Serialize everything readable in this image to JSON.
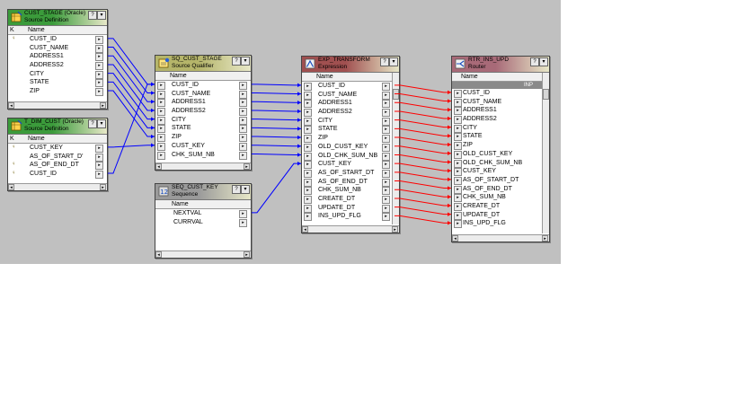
{
  "colors": {
    "source_header": "#3b9b3b",
    "qualifier_header": "#b5b56a",
    "sequence_header": "#9a9a9a",
    "expression_header": "#a05050",
    "router_header": "#a86a78",
    "wire_blue": "#0000ff",
    "wire_red": "#ff0000"
  },
  "transforms": [
    {
      "id": "src1",
      "title": "CUST_STAGE (Oracle)",
      "subtitle": "Source Definition",
      "icon": "source-definition-icon",
      "header": {
        "key": "K",
        "name": "Name"
      },
      "ports": [
        {
          "key": "key-icon",
          "name": "CUST_ID"
        },
        {
          "name": "CUST_NAME"
        },
        {
          "name": "ADDRESS1"
        },
        {
          "name": "ADDRESS2"
        },
        {
          "name": "CITY"
        },
        {
          "name": "STATE"
        },
        {
          "name": "ZIP"
        }
      ]
    },
    {
      "id": "src2",
      "title": "T_DIM_CUST (Oracle)",
      "subtitle": "Source Definition",
      "icon": "source-definition-icon",
      "header": {
        "key": "K",
        "name": "Name"
      },
      "ports": [
        {
          "key": "key-icon",
          "name": "CUST_KEY"
        },
        {
          "name": "AS_OF_START_D'"
        },
        {
          "key": "key-icon",
          "name": "AS_OF_END_DT"
        },
        {
          "key": "key-icon",
          "name": "CUST_ID"
        }
      ]
    },
    {
      "id": "sq",
      "title": "SQ_CUST_STAGE",
      "subtitle": "Source Qualifier",
      "icon": "source-qualifier-icon",
      "header": {
        "name": "Name"
      },
      "ports": [
        {
          "name": "CUST_ID"
        },
        {
          "name": "CUST_NAME"
        },
        {
          "name": "ADDRESS1"
        },
        {
          "name": "ADDRESS2"
        },
        {
          "name": "CITY"
        },
        {
          "name": "STATE"
        },
        {
          "name": "ZIP"
        },
        {
          "name": "CUST_KEY"
        },
        {
          "name": "CHK_SUM_NB"
        }
      ]
    },
    {
      "id": "seq",
      "title": "SEQ_CUST_KEY",
      "subtitle": "Sequence",
      "icon": "sequence-icon",
      "header": {
        "name": "Name"
      },
      "ports": [
        {
          "name": "NEXTVAL"
        },
        {
          "name": "CURRVAL"
        }
      ]
    },
    {
      "id": "exp",
      "title": "EXP_TRANSFORM",
      "subtitle": "Expression",
      "icon": "expression-icon",
      "header": {
        "name": "Name"
      },
      "ports": [
        {
          "name": "CUST_ID"
        },
        {
          "name": "CUST_NAME"
        },
        {
          "name": "ADDRESS1"
        },
        {
          "name": "ADDRESS2"
        },
        {
          "name": "CITY"
        },
        {
          "name": "STATE"
        },
        {
          "name": "ZIP"
        },
        {
          "name": "OLD_CUST_KEY"
        },
        {
          "name": "OLD_CHK_SUM_NB"
        },
        {
          "name": "CUST_KEY"
        },
        {
          "name": "AS_OF_START_DT"
        },
        {
          "name": "AS_OF_END_DT"
        },
        {
          "name": "CHK_SUM_NB"
        },
        {
          "name": "CREATE_DT"
        },
        {
          "name": "UPDATE_DT"
        },
        {
          "name": "INS_UPD_FLG"
        }
      ]
    },
    {
      "id": "rtr",
      "title": "RTR_INS_UPD",
      "subtitle": "Router",
      "icon": "router-icon",
      "header": {
        "name": "Name"
      },
      "group_label": "INP",
      "ports": [
        {
          "name": "CUST_ID"
        },
        {
          "name": "CUST_NAME"
        },
        {
          "name": "ADDRESS1"
        },
        {
          "name": "ADDRESS2"
        },
        {
          "name": "CITY"
        },
        {
          "name": "STATE"
        },
        {
          "name": "ZIP"
        },
        {
          "name": "OLD_CUST_KEY"
        },
        {
          "name": "OLD_CHK_SUM_NB"
        },
        {
          "name": "CUST_KEY"
        },
        {
          "name": "AS_OF_START_DT"
        },
        {
          "name": "AS_OF_END_DT"
        },
        {
          "name": "CHK_SUM_NB"
        },
        {
          "name": "CREATE_DT"
        },
        {
          "name": "UPDATE_DT"
        },
        {
          "name": "INS_UPD_FLG"
        }
      ]
    }
  ],
  "links": [
    {
      "from": "src1.0",
      "to": "sq.0",
      "color": "blue"
    },
    {
      "from": "src1.1",
      "to": "sq.1",
      "color": "blue"
    },
    {
      "from": "src1.2",
      "to": "sq.2",
      "color": "blue"
    },
    {
      "from": "src1.3",
      "to": "sq.3",
      "color": "blue"
    },
    {
      "from": "src1.4",
      "to": "sq.4",
      "color": "blue"
    },
    {
      "from": "src1.5",
      "to": "sq.5",
      "color": "blue"
    },
    {
      "from": "src1.6",
      "to": "sq.6",
      "color": "blue"
    },
    {
      "from": "src2.0",
      "to": "sq.7",
      "color": "blue"
    },
    {
      "from": "src2.3",
      "to": "sq.0",
      "color": "blue"
    },
    {
      "from": "sq.0",
      "to": "exp.0",
      "color": "blue"
    },
    {
      "from": "sq.1",
      "to": "exp.1",
      "color": "blue"
    },
    {
      "from": "sq.2",
      "to": "exp.2",
      "color": "blue"
    },
    {
      "from": "sq.3",
      "to": "exp.3",
      "color": "blue"
    },
    {
      "from": "sq.4",
      "to": "exp.4",
      "color": "blue"
    },
    {
      "from": "sq.5",
      "to": "exp.5",
      "color": "blue"
    },
    {
      "from": "sq.6",
      "to": "exp.6",
      "color": "blue"
    },
    {
      "from": "sq.7",
      "to": "exp.7",
      "color": "blue"
    },
    {
      "from": "sq.8",
      "to": "exp.8",
      "color": "blue"
    },
    {
      "from": "seq.0",
      "to": "exp.9",
      "color": "blue"
    },
    {
      "from": "exp.0",
      "to": "rtr.0",
      "color": "red"
    },
    {
      "from": "exp.1",
      "to": "rtr.1",
      "color": "red"
    },
    {
      "from": "exp.2",
      "to": "rtr.2",
      "color": "red"
    },
    {
      "from": "exp.3",
      "to": "rtr.3",
      "color": "red"
    },
    {
      "from": "exp.4",
      "to": "rtr.4",
      "color": "red"
    },
    {
      "from": "exp.5",
      "to": "rtr.5",
      "color": "red"
    },
    {
      "from": "exp.6",
      "to": "rtr.6",
      "color": "red"
    },
    {
      "from": "exp.7",
      "to": "rtr.7",
      "color": "red"
    },
    {
      "from": "exp.8",
      "to": "rtr.8",
      "color": "red"
    },
    {
      "from": "exp.9",
      "to": "rtr.9",
      "color": "red"
    },
    {
      "from": "exp.10",
      "to": "rtr.10",
      "color": "red"
    },
    {
      "from": "exp.11",
      "to": "rtr.11",
      "color": "red"
    },
    {
      "from": "exp.12",
      "to": "rtr.12",
      "color": "red"
    },
    {
      "from": "exp.13",
      "to": "rtr.13",
      "color": "red"
    },
    {
      "from": "exp.14",
      "to": "rtr.14",
      "color": "red"
    },
    {
      "from": "exp.15",
      "to": "rtr.15",
      "color": "red"
    }
  ]
}
